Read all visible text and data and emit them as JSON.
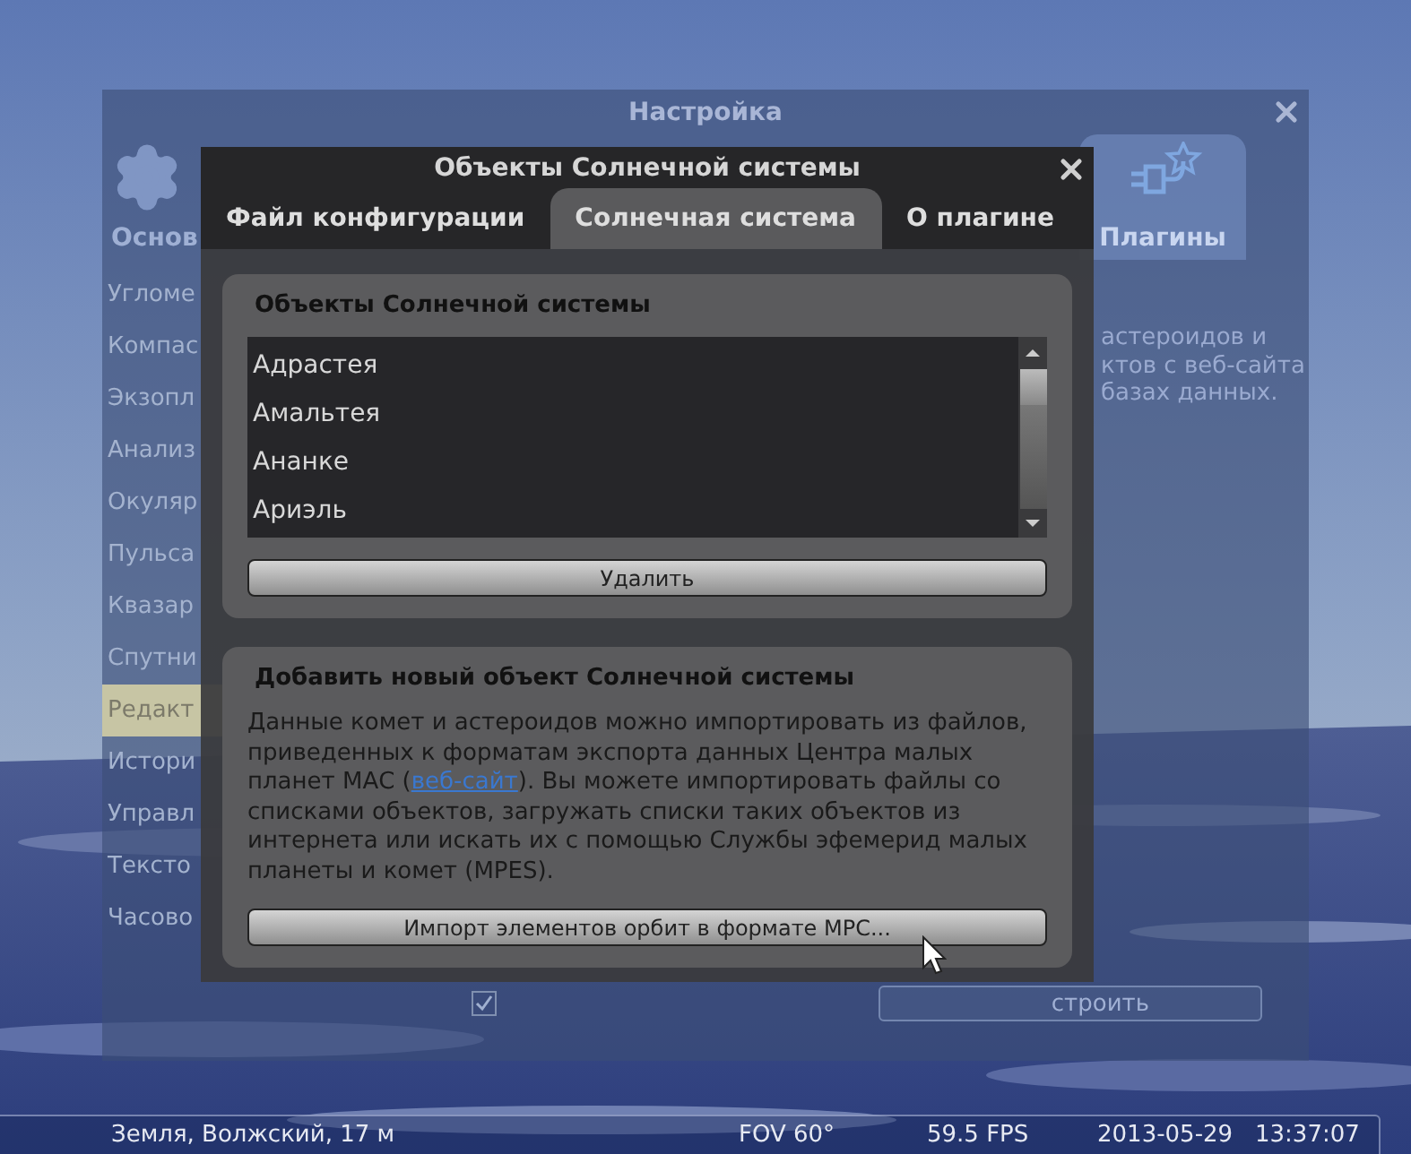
{
  "background_window": {
    "title": "Настройка",
    "tabs": [
      {
        "label": "Основ",
        "selected": false
      },
      {
        "label": "Плагины",
        "selected": true
      }
    ],
    "sidebar_items": [
      {
        "label": "Угломе",
        "selected": false
      },
      {
        "label": "Компас",
        "selected": false
      },
      {
        "label": "Экзопл",
        "selected": false
      },
      {
        "label": "Анализ",
        "selected": false
      },
      {
        "label": "Окуляр",
        "selected": false
      },
      {
        "label": "Пульса",
        "selected": false
      },
      {
        "label": "Квазар",
        "selected": false
      },
      {
        "label": "Спутни",
        "selected": false
      },
      {
        "label": "Редакт",
        "selected": true
      },
      {
        "label": "Истори",
        "selected": false
      },
      {
        "label": "Управл",
        "selected": false
      },
      {
        "label": "Тексто",
        "selected": false
      },
      {
        "label": "Часово",
        "selected": false
      }
    ],
    "description_fragments": [
      "астероидов и",
      "ктов с веб-сайта",
      "базах данных."
    ],
    "load_at_startup": {
      "checked": true
    },
    "configure_button": "строить"
  },
  "dialog": {
    "title": "Объекты Солнечной системы",
    "tabs": [
      {
        "label": "Файл конфигурации",
        "selected": false
      },
      {
        "label": "Солнечная система",
        "selected": true
      },
      {
        "label": "О плагине",
        "selected": false
      }
    ],
    "objects_group": {
      "title": "Объекты Солнечной системы",
      "objects": [
        "Адрастея",
        "Амальтея",
        "Ананке",
        "Ариэль"
      ],
      "remove_button": "Удалить"
    },
    "add_group": {
      "title": "Добавить новый объект Солнечной системы",
      "text_before": "Данные комет и астероидов можно импортировать из файлов, приведенных к форматам экспорта данных Центра малых планет МАС (",
      "link": "веб-сайт",
      "text_after": "). Вы можете импортировать файлы со списками объектов, загружать списки таких объектов из интернета или искать их с помощью Службы эфемерид малых планеты и комет (MPES).",
      "import_button": "Импорт элементов орбит в формате MPC..."
    }
  },
  "status_bar": {
    "location": "Земля, Волжский, 17 м",
    "fov": "FOV 60°",
    "fps": "59.5 FPS",
    "date": "2013-05-29",
    "time": "13:37:07"
  }
}
